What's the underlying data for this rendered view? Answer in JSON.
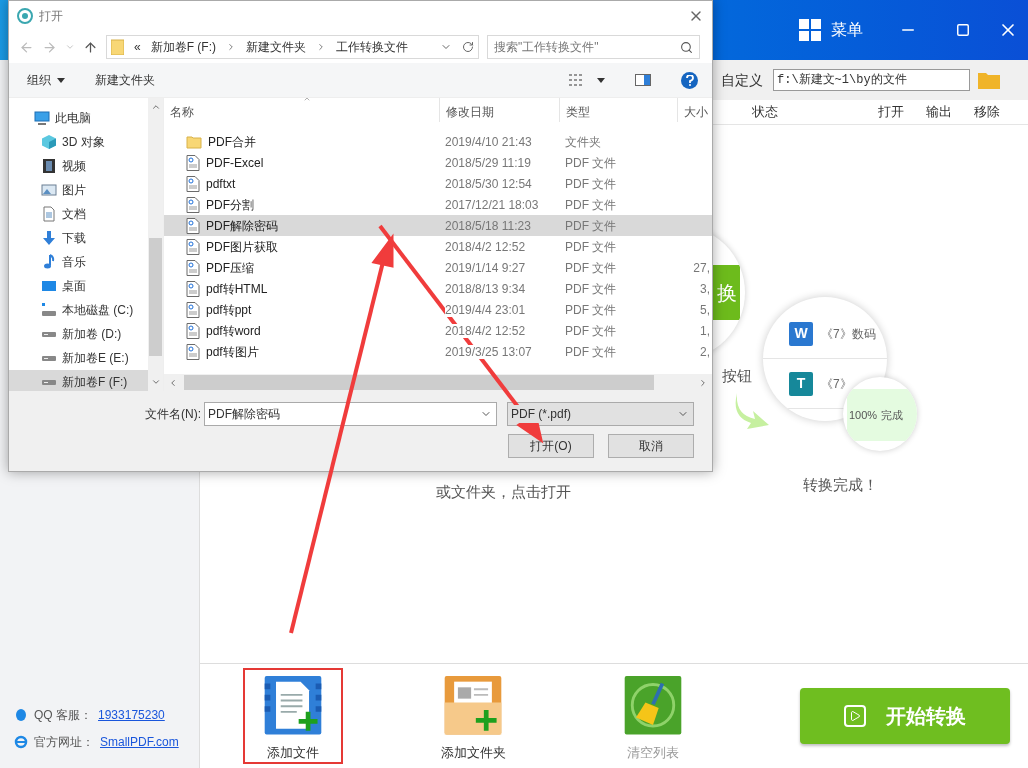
{
  "app": {
    "menu_label": "菜单",
    "custom_label": "自定义",
    "output_path": "f:\\新建文~1\\by的文件",
    "columns": [
      "状态",
      "打开",
      "输出",
      "移除"
    ],
    "illustration": {
      "button_char": "换",
      "hint_fragment": "按钮",
      "hint_text": "或文件夹，点击打开",
      "done_text": "转换完成！",
      "rows": [
        {
          "kind": "word",
          "icon_letter": "W",
          "name": "《7》数码"
        },
        {
          "kind": "text",
          "icon_letter": "T",
          "name": "《7》"
        }
      ],
      "progress": "100%",
      "progress_status": "完成"
    },
    "contact": [
      {
        "kind": "qq",
        "label": "QQ 客服：",
        "link": "1933175230"
      },
      {
        "kind": "web",
        "label": "官方网址：",
        "link": "SmallPDF.com"
      }
    ],
    "toolbar": [
      {
        "kind": "add-file",
        "label": "添加文件",
        "disabled": false,
        "annotated": true
      },
      {
        "kind": "add-folder",
        "label": "添加文件夹",
        "disabled": false,
        "annotated": false
      },
      {
        "kind": "clear",
        "label": "清空列表",
        "disabled": true,
        "annotated": false
      }
    ],
    "start_button": "开始转换"
  },
  "dialog": {
    "title": "打开",
    "breadcrumb_more": "«",
    "breadcrumb": [
      "新加卷F (F:)",
      "新建文件夹",
      "工作转换文件"
    ],
    "search_placeholder": "搜索\"工作转换文件\"",
    "toolbar": [
      "组织",
      "新建文件夹"
    ],
    "nav": [
      {
        "kind": "pc",
        "label": "此电脑",
        "selected": false,
        "children": [
          {
            "kind": "cube",
            "label": "3D 对象",
            "selected": false
          },
          {
            "kind": "video",
            "label": "视频",
            "selected": false
          },
          {
            "kind": "picture",
            "label": "图片",
            "selected": false
          },
          {
            "kind": "doc",
            "label": "文档",
            "selected": false
          },
          {
            "kind": "download",
            "label": "下载",
            "selected": false
          },
          {
            "kind": "music",
            "label": "音乐",
            "selected": false
          },
          {
            "kind": "desktop",
            "label": "桌面",
            "selected": false
          },
          {
            "kind": "system-drive",
            "label": "本地磁盘 (C:)",
            "selected": false
          },
          {
            "kind": "drive",
            "label": "新加卷 (D:)",
            "selected": false
          },
          {
            "kind": "drive",
            "label": "新加卷E (E:)",
            "selected": false
          },
          {
            "kind": "drive",
            "label": "新加卷F (F:)",
            "selected": true
          }
        ]
      }
    ],
    "columns": [
      "名称",
      "修改日期",
      "类型",
      "大小"
    ],
    "files": [
      {
        "kind": "folder",
        "name": "PDF合并",
        "date": "2019/4/10 21:43",
        "type": "文件夹",
        "selected": false
      },
      {
        "kind": "pdf",
        "name": "PDF-Excel",
        "date": "2018/5/29 11:19",
        "type": "PDF 文件",
        "selected": false
      },
      {
        "kind": "pdf",
        "name": "pdftxt",
        "date": "2018/5/30 12:54",
        "type": "PDF 文件",
        "selected": false
      },
      {
        "kind": "pdf",
        "name": "PDF分割",
        "date": "2017/12/21 18:03",
        "type": "PDF 文件",
        "selected": false
      },
      {
        "kind": "pdf",
        "name": "PDF解除密码",
        "date": "2018/5/18 11:23",
        "type": "PDF 文件",
        "selected": true
      },
      {
        "kind": "pdf",
        "name": "PDF图片获取",
        "date": "2018/4/2 12:52",
        "type": "PDF 文件",
        "selected": false
      },
      {
        "kind": "pdf",
        "name": "PDF压缩",
        "date": "2019/1/14 9:27",
        "type": "PDF 文件",
        "size": "27,",
        "selected": false
      },
      {
        "kind": "pdf",
        "name": "pdf转HTML",
        "date": "2018/8/13 9:34",
        "type": "PDF 文件",
        "size": "3,",
        "selected": false
      },
      {
        "kind": "pdf",
        "name": "pdf转ppt",
        "date": "2019/4/4 23:01",
        "type": "PDF 文件",
        "size": "5,",
        "selected": false
      },
      {
        "kind": "pdf",
        "name": "pdf转word",
        "date": "2018/4/2 12:52",
        "type": "PDF 文件",
        "size": "1,",
        "selected": false
      },
      {
        "kind": "pdf",
        "name": "pdf转图片",
        "date": "2019/3/25 13:07",
        "type": "PDF 文件",
        "size": "2,",
        "selected": false
      }
    ],
    "filename_label": "文件名(N):",
    "filename": "PDF解除密码",
    "filetype": "PDF (*.pdf)",
    "buttons": [
      "打开(O)",
      "取消"
    ]
  }
}
